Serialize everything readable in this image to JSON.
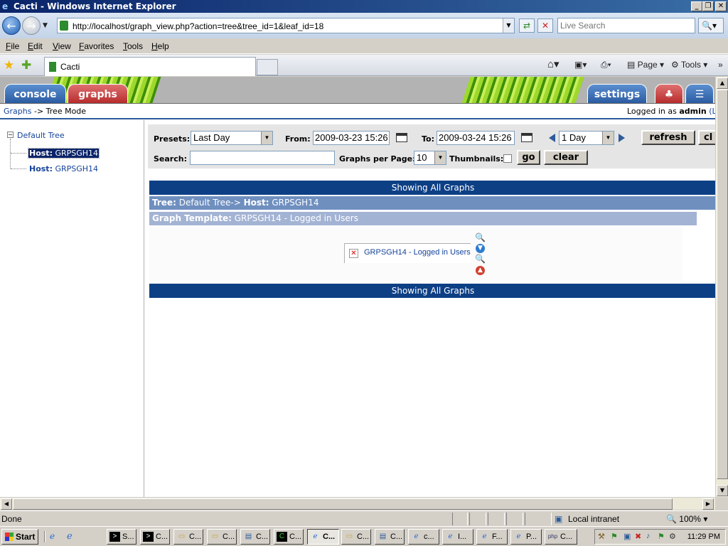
{
  "window": {
    "title": "Cacti - Windows Internet Explorer"
  },
  "browser": {
    "url": "http://localhost/graph_view.php?action=tree&tree_id=1&leaf_id=18",
    "search_placeholder": "Live Search",
    "menu": [
      "File",
      "Edit",
      "View",
      "Favorites",
      "Tools",
      "Help"
    ],
    "tab_title": "Cacti",
    "commands": {
      "page": "Page",
      "tools": "Tools"
    }
  },
  "cacti": {
    "tabs": {
      "console": "console",
      "graphs": "graphs",
      "settings": "settings"
    },
    "breadcrumb": {
      "root": "Graphs",
      "sep": "->",
      "current": "Tree Mode"
    },
    "login": {
      "prefix": "Logged in as",
      "user": "admin",
      "suffix": "(L"
    },
    "tree": {
      "root": "Default Tree",
      "nodes": [
        {
          "prefix": "Host:",
          "name": "GRPSGH14",
          "selected": true
        },
        {
          "prefix": "Host:",
          "name": "GRPSGH14",
          "selected": false
        }
      ]
    },
    "filter": {
      "presets_label": "Presets:",
      "presets_value": "Last Day",
      "from_label": "From:",
      "from_value": "2009-03-23 15:26",
      "to_label": "To:",
      "to_value": "2009-03-24 15:26",
      "timespan_value": "1 Day",
      "refresh_label": "refresh",
      "clear_label_cut": "cl",
      "search_label": "Search:",
      "search_value": "",
      "per_page_label": "Graphs per Page:",
      "per_page_value": "10",
      "thumbnails_label": "Thumbnails:",
      "thumbnails_checked": false,
      "go_label": "go",
      "clear_label": "clear"
    },
    "listing": {
      "showing_all": "Showing All Graphs",
      "tree_label": "Tree:",
      "tree_value": "Default Tree->",
      "host_label": "Host:",
      "host_value": "GRPSGH14",
      "template_label": "Graph Template:",
      "template_value": "GRPSGH14 - Logged in Users",
      "graph_alt": "GRPSGH14 - Logged in Users"
    }
  },
  "status": {
    "text": "Done",
    "zone": "Local intranet",
    "zoom": "100%"
  },
  "taskbar": {
    "start": "Start",
    "buttons": [
      "S...",
      "C...",
      "C...",
      "C...",
      "C...",
      "C...",
      "C...",
      "C...",
      "C...",
      "c...",
      "I...",
      "F...",
      "P...",
      "C..."
    ],
    "clock": "11:29 PM"
  }
}
